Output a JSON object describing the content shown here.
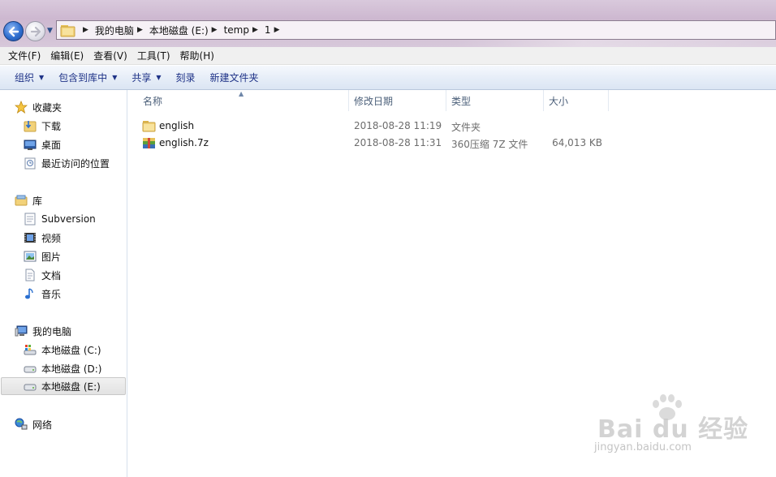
{
  "address": {
    "crumbs": [
      "我的电脑",
      "本地磁盘 (E:)",
      "temp",
      "1"
    ]
  },
  "menu": [
    "文件(F)",
    "编辑(E)",
    "查看(V)",
    "工具(T)",
    "帮助(H)"
  ],
  "commands": [
    {
      "label": "组织",
      "dropdown": true
    },
    {
      "label": "包含到库中",
      "dropdown": true
    },
    {
      "label": "共享",
      "dropdown": true
    },
    {
      "label": "刻录",
      "dropdown": false
    },
    {
      "label": "新建文件夹",
      "dropdown": false
    }
  ],
  "nav": {
    "favorites": {
      "label": "收藏夹",
      "items": [
        "下载",
        "桌面",
        "最近访问的位置"
      ]
    },
    "libraries": {
      "label": "库",
      "items": [
        "Subversion",
        "视频",
        "图片",
        "文档",
        "音乐"
      ]
    },
    "computer": {
      "label": "我的电脑",
      "items": [
        "本地磁盘 (C:)",
        "本地磁盘 (D:)",
        "本地磁盘 (E:)"
      ]
    },
    "network": {
      "label": "网络"
    }
  },
  "columns": {
    "name": "名称",
    "date": "修改日期",
    "type": "类型",
    "size": "大小"
  },
  "files": [
    {
      "name": "english",
      "date": "2018-08-28 11:19",
      "type": "文件夹",
      "size": "",
      "icon": "folder-icon"
    },
    {
      "name": "english.7z",
      "date": "2018-08-28 11:31",
      "type": "360压缩 7Z 文件",
      "size": "64,013 KB",
      "icon": "archive-icon"
    }
  ],
  "watermark": {
    "brand": "Bai du 经验",
    "url": "jingyan.baidu.com"
  },
  "colors": {
    "accent": "#1e3287",
    "selection": "#e5e5e5",
    "titlebar": "#cdb8d0"
  }
}
